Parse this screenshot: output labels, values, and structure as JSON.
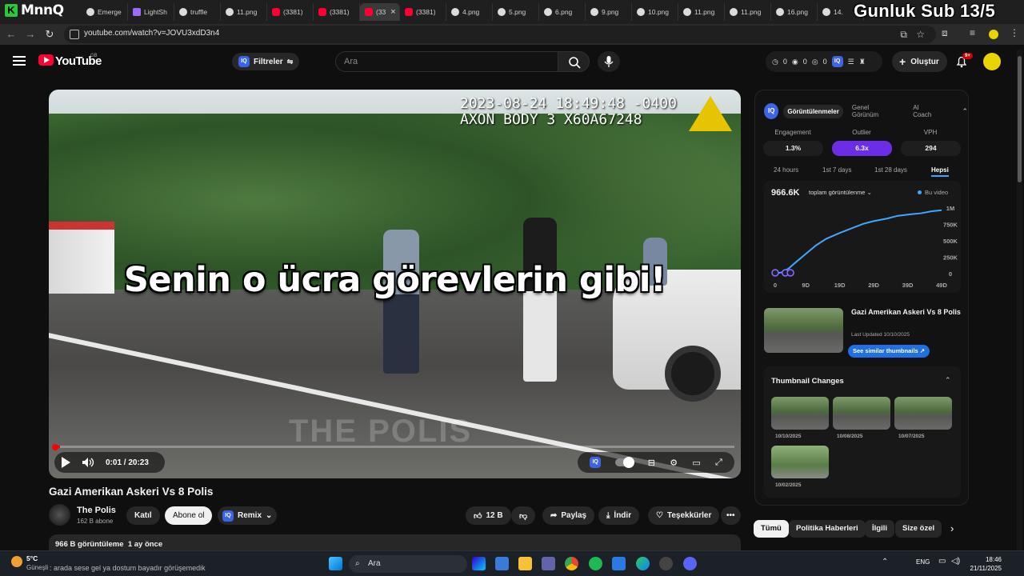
{
  "overlay": {
    "title": "Gunluk Sub 13/5"
  },
  "browser": {
    "brand": "MnnQ",
    "tabs": [
      {
        "label": "Emerge",
        "icon": "edge-icon"
      },
      {
        "label": "LightSh",
        "icon": "pen-icon"
      },
      {
        "label": "truffle",
        "icon": "google-icon"
      },
      {
        "label": "11.png",
        "icon": "globe-icon"
      },
      {
        "label": "(3381)",
        "icon": "youtube-icon"
      },
      {
        "label": "(3381)",
        "icon": "youtube-icon"
      },
      {
        "label": "(33",
        "icon": "youtube-icon",
        "active": true
      },
      {
        "label": "(3381)",
        "icon": "youtube-icon"
      },
      {
        "label": "4.png",
        "icon": "globe-icon"
      },
      {
        "label": "5.png",
        "icon": "globe-icon"
      },
      {
        "label": "6.png",
        "icon": "globe-icon"
      },
      {
        "label": "9.png",
        "icon": "globe-icon"
      },
      {
        "label": "10.png",
        "icon": "globe-icon"
      },
      {
        "label": "11.png",
        "icon": "globe-icon"
      },
      {
        "label": "11.png",
        "icon": "globe-icon"
      },
      {
        "label": "16.png",
        "icon": "globe-icon"
      },
      {
        "label": "14.",
        "icon": "globe-icon"
      }
    ],
    "url": "youtube.com/watch?v=JOVU3xdD3n4"
  },
  "youtube": {
    "logo_text": "YouTube",
    "region": "GB",
    "filters_label": "Filtreler",
    "search_placeholder": "Ara",
    "counts": [
      "0",
      "0",
      "0"
    ],
    "create_label": "Oluştur",
    "notif_badge": "9+"
  },
  "video": {
    "timestamp_line1": "2023-08-24 18:49:48 -0400",
    "timestamp_line2": "AXON BODY 3 X60A67248",
    "caption": "Senin o ücra görevlerin gibi!",
    "watermark": "THE POLIS",
    "time": "0:01 / 20:23",
    "progress": 0.001
  },
  "meta": {
    "title": "Gazi Amerikan Askeri Vs 8 Polis",
    "channel": "The Polis",
    "subs": "162 B abone",
    "join": "Katıl",
    "subscribe": "Abone ol",
    "remix": "Remix",
    "likes": "12 B",
    "share": "Paylaş",
    "download": "İndir",
    "thanks": "Teşekkürler",
    "views": "966 B görüntüleme",
    "age": "1 ay önce"
  },
  "panel": {
    "tabs": [
      "Görüntülenmeler",
      "Genel Görünüm",
      "AI Coach"
    ],
    "metrics": [
      {
        "label": "Engagement",
        "value": "1.3%"
      },
      {
        "label": "Outlier",
        "value": "6.3x",
        "highlight": true
      },
      {
        "label": "VPH",
        "value": "294"
      }
    ],
    "ranges": [
      "24 hours",
      "1st 7 days",
      "1st 28 days",
      "Hepsi"
    ],
    "total_views": "966.6K",
    "dropdown": "toplam görüntülenme",
    "legend": "Bu video",
    "thumb_title": "Gazi Amerikan Askeri Vs 8 Polis",
    "last_updated": "Last Updated 10/10/2025",
    "similar_btn": "See similar thumbnails",
    "thumb_changes_title": "Thumbnail Changes",
    "thumb_dates": [
      "10/10/2025",
      "10/08/2025",
      "10/07/2025",
      "10/02/2025"
    ]
  },
  "chart_data": {
    "type": "line",
    "x_ticks": [
      "0",
      "9D",
      "19D",
      "29D",
      "39D",
      "49D"
    ],
    "y_ticks": [
      "0",
      "250K",
      "500K",
      "750K",
      "1M"
    ],
    "ylim": [
      0,
      1000000
    ],
    "xlim": [
      0,
      49
    ],
    "series": [
      {
        "name": "Bu video",
        "x": [
          0,
          2,
          4,
          6,
          9,
          12,
          15,
          19,
          23,
          26,
          29,
          33,
          36,
          39,
          43,
          46,
          49
        ],
        "y": [
          0,
          20000,
          80000,
          170000,
          300000,
          430000,
          530000,
          620000,
          700000,
          760000,
          800000,
          840000,
          880000,
          900000,
          920000,
          950000,
          966600
        ]
      }
    ]
  },
  "chips": [
    "Tümü",
    "Politika Haberleri",
    "İlgili",
    "Size özel"
  ],
  "taskbar": {
    "temp": "5°C",
    "weather": "Güneşli",
    "marquee": ": arada sese gel ya dostum bayadır görüşemedik",
    "search": "Ara",
    "lang": "ENG",
    "time": "18:46",
    "date": "21/11/2025"
  }
}
